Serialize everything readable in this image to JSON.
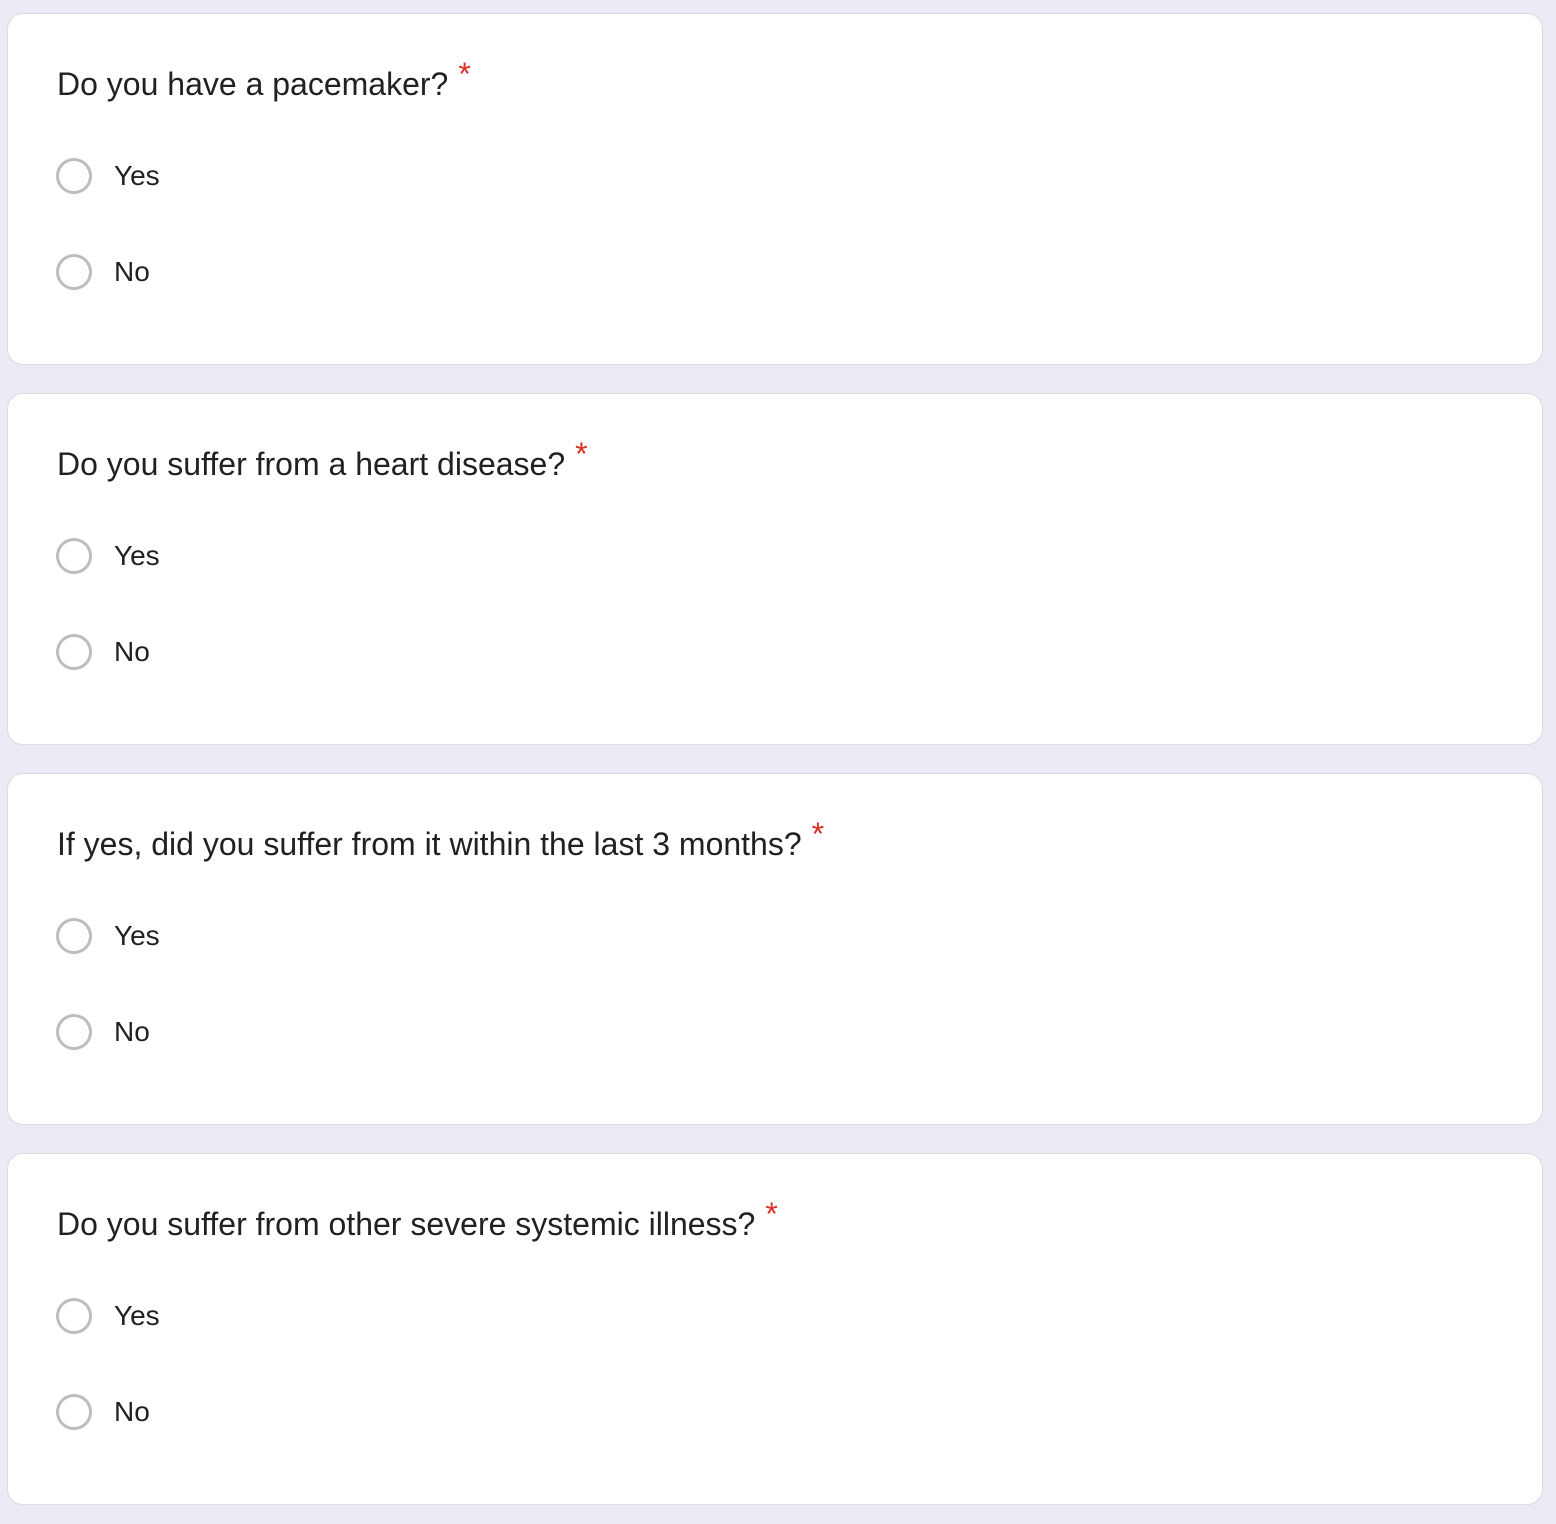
{
  "questions": [
    {
      "title": "Do you have a pacemaker?",
      "required_mark": "*",
      "options": [
        "Yes",
        "No"
      ]
    },
    {
      "title": "Do you suffer from a heart disease?",
      "required_mark": "*",
      "options": [
        "Yes",
        "No"
      ]
    },
    {
      "title": "If yes, did you suffer from it within the last 3 months?",
      "required_mark": "*",
      "options": [
        "Yes",
        "No"
      ]
    },
    {
      "title": "Do you suffer from other severe systemic illness?",
      "required_mark": "*",
      "options": [
        "Yes",
        "No"
      ]
    }
  ],
  "colors": {
    "page_background": "#edeaf5",
    "card_background": "#ffffff",
    "required_star": "#d93025",
    "radio_border": "#bdbdbd",
    "text": "#202124"
  }
}
